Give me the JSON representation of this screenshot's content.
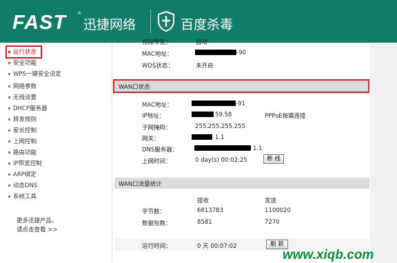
{
  "header": {
    "brand": "FAST",
    "tm": "®",
    "brand_cn": "迅捷网络",
    "partner": "百度杀毒"
  },
  "sidebar": {
    "items": [
      {
        "label": "运行状态"
      },
      {
        "label": "安全功能"
      },
      {
        "label": "WPS一键安全设定"
      },
      {
        "label": "网络参数"
      },
      {
        "label": "无线设置"
      },
      {
        "label": "DHCP服务器"
      },
      {
        "label": "转发规则"
      },
      {
        "label": "家长控制"
      },
      {
        "label": "上网控制"
      },
      {
        "label": "路由功能"
      },
      {
        "label": "IP带宽控制"
      },
      {
        "label": "ARP绑定"
      },
      {
        "label": "动态DNS"
      },
      {
        "label": "系统工具"
      }
    ],
    "more_line1": "更多迅捷产品，",
    "more_line2": "请点击查看 >>"
  },
  "wireless": {
    "bandwidth_label": "频段带宽：",
    "bandwidth_value": "自动",
    "mac_label": "MAC地址：",
    "mac_suffix": "-90",
    "wds_label": "WDS状态：",
    "wds_value": "未开启"
  },
  "wan": {
    "title": "WAN口状态",
    "mac_label": "MAC地址：",
    "mac_suffix": "-91",
    "ip_label": "IP地址：",
    "ip_suffix": "59.58",
    "conn_type": "PPPoE按需连接",
    "mask_label": "子网掩码：",
    "mask_value": "255.255.255.255",
    "gw_label": "网关：",
    "gw_suffix": "1.1",
    "dns_label": "DNS服务器：",
    "dns_suffix": "1.1",
    "uptime_label": "上网时间：",
    "uptime_value": "0 day(s) 00:02:25",
    "disconnect_btn": "断 线"
  },
  "traffic": {
    "title": "WAN口流量统计",
    "col_recv": "接收",
    "col_send": "发送",
    "bytes_label": "字节数：",
    "bytes_recv": "6813783",
    "bytes_send": "1100020",
    "pkts_label": "数据包数：",
    "pkts_recv": "8581",
    "pkts_send": "7270"
  },
  "runtime": {
    "label": "运行时间：",
    "value": "0 天 00:07:02",
    "refresh_btn": "刷 新"
  },
  "watermark": "www.xiqb.com",
  "colors": {
    "header": "#117d66",
    "highlight": "#d01f2f",
    "section": "#dcdcdc"
  }
}
